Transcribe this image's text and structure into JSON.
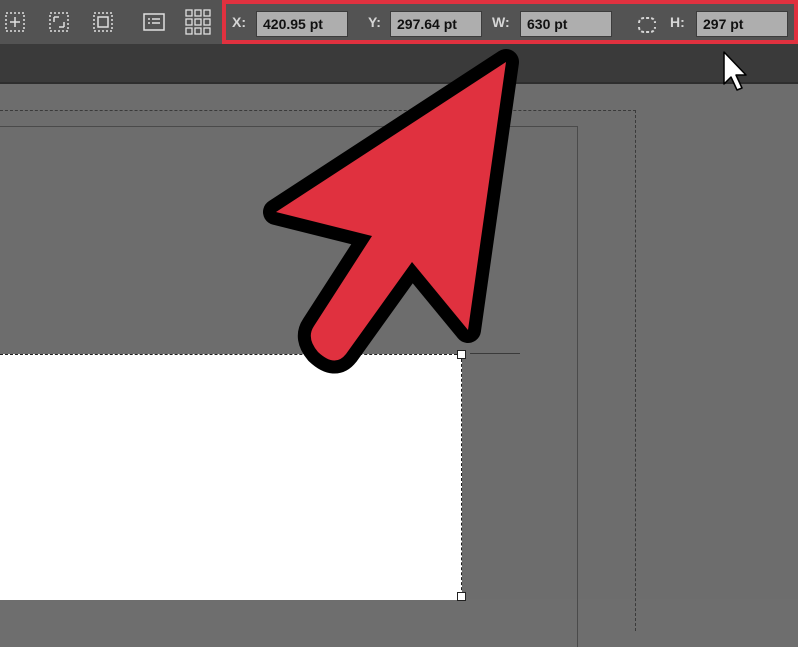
{
  "toolbar": {
    "icons": [
      "align-center-icon",
      "align-corner-icon",
      "frame-fit-icon",
      "list-icon",
      "grid-icon"
    ],
    "transform": {
      "x_label": "X:",
      "x_value": "420.95 pt",
      "y_label": "Y:",
      "y_value": "297.64 pt",
      "w_label": "W:",
      "w_value": "630 pt",
      "h_label": "H:",
      "h_value": "297 pt",
      "highlight_color": "#e0313f"
    }
  },
  "annotation": {
    "arrow_color": "#e0313f"
  }
}
